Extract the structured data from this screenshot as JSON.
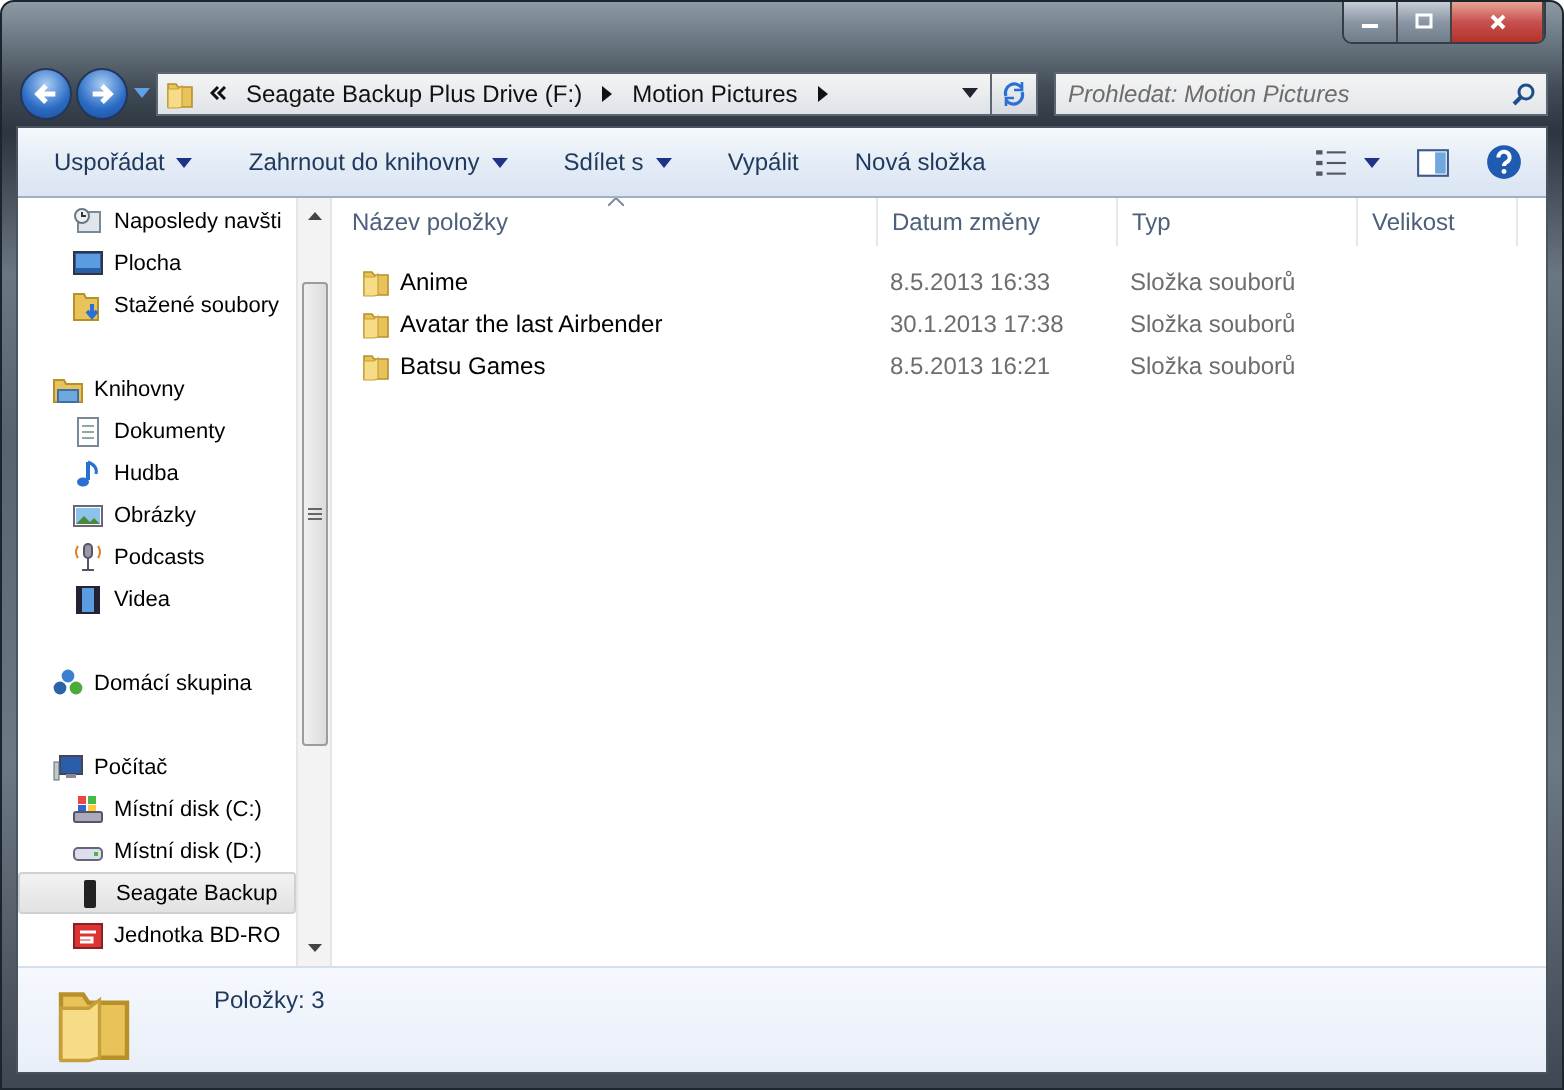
{
  "address_bar": {
    "segments": [
      "Seagate Backup Plus Drive (F:)",
      "Motion Pictures"
    ]
  },
  "search": {
    "placeholder": "Prohledat: Motion Pictures"
  },
  "toolbar": {
    "buttons": [
      {
        "label": "Uspořádat",
        "has_menu": true
      },
      {
        "label": "Zahrnout do knihovny",
        "has_menu": true
      },
      {
        "label": "Sdílet s",
        "has_menu": true
      },
      {
        "label": "Vypálit",
        "has_menu": false
      },
      {
        "label": "Nová složka",
        "has_menu": false
      }
    ]
  },
  "sidebar": {
    "sections": [
      {
        "children": [
          {
            "label": "Naposledy navšti",
            "kind": "recent",
            "selected": false
          },
          {
            "label": "Plocha",
            "kind": "desktop",
            "selected": false
          },
          {
            "label": "Stažené soubory",
            "kind": "downloads",
            "selected": false
          }
        ]
      },
      {
        "label": "Knihovny",
        "kind": "library",
        "children": [
          {
            "label": "Dokumenty",
            "kind": "documents",
            "selected": false
          },
          {
            "label": "Hudba",
            "kind": "music",
            "selected": false
          },
          {
            "label": "Obrázky",
            "kind": "pictures",
            "selected": false
          },
          {
            "label": "Podcasts",
            "kind": "podcasts",
            "selected": false
          },
          {
            "label": "Videa",
            "kind": "videos",
            "selected": false
          }
        ]
      },
      {
        "label": "Domácí skupina",
        "kind": "homegroup"
      },
      {
        "label": "Počítač",
        "kind": "computer",
        "children": [
          {
            "label": "Místní disk (C:)",
            "kind": "system-disk",
            "selected": false
          },
          {
            "label": "Místní disk (D:)",
            "kind": "disk",
            "selected": false
          },
          {
            "label": "Seagate Backup",
            "kind": "external-drive",
            "selected": true
          },
          {
            "label": "Jednotka BD-RO",
            "kind": "optical-drive",
            "selected": false
          }
        ]
      }
    ]
  },
  "table": {
    "columns": [
      {
        "label": "Název položky",
        "sorted": true
      },
      {
        "label": "Datum změny",
        "sorted": false
      },
      {
        "label": "Typ",
        "sorted": false
      },
      {
        "label": "Velikost",
        "sorted": false
      }
    ],
    "rows": [
      {
        "name": "Anime",
        "date": "8.5.2013 16:33",
        "type": "Složka souborů",
        "selected": false
      },
      {
        "name": "Avatar the last Airbender",
        "date": "30.1.2013 17:38",
        "type": "Složka souborů",
        "selected": false
      },
      {
        "name": "Batsu Games",
        "date": "8.5.2013 16:21",
        "type": "Složka souborů",
        "selected": false
      }
    ]
  },
  "status_bar": {
    "text": "Položky: 3"
  }
}
